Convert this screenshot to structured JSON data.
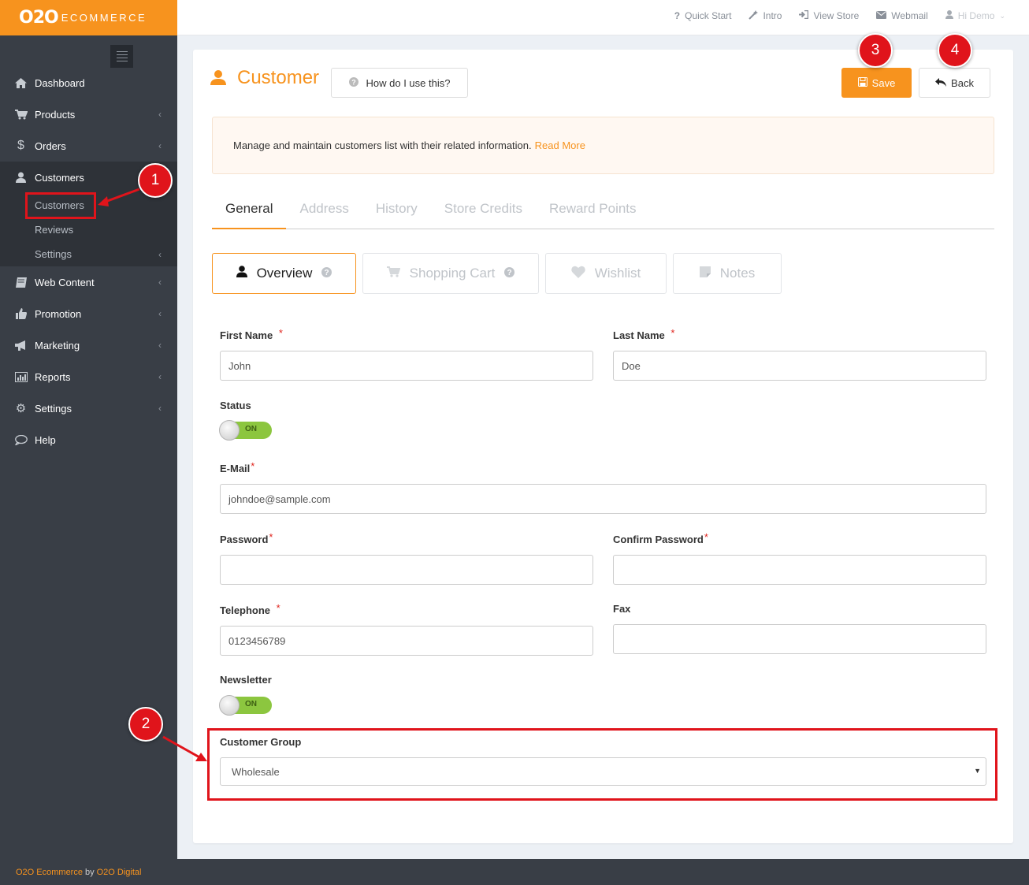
{
  "brand": {
    "logo_main": "O2O",
    "logo_sub": "ECOMMERCE"
  },
  "sidebar": {
    "items": [
      {
        "label": "Dashboard"
      },
      {
        "label": "Products"
      },
      {
        "label": "Orders"
      },
      {
        "label": "Customers",
        "children": [
          {
            "label": "Customers"
          },
          {
            "label": "Reviews"
          },
          {
            "label": "Settings"
          }
        ]
      },
      {
        "label": "Web Content"
      },
      {
        "label": "Promotion"
      },
      {
        "label": "Marketing"
      },
      {
        "label": "Reports"
      },
      {
        "label": "Settings"
      },
      {
        "label": "Help"
      }
    ]
  },
  "topbar": {
    "quick_start": "Quick Start",
    "intro": "Intro",
    "view_store": "View Store",
    "webmail": "Webmail",
    "user": "Hi Demo"
  },
  "page": {
    "title": "Customer",
    "help_label": "How do I use this?",
    "save_label": "Save",
    "back_label": "Back",
    "info_text": "Manage and maintain customers list with their related information.",
    "read_more": "Read More"
  },
  "tabs": [
    "General",
    "Address",
    "History",
    "Store Credits",
    "Reward Points"
  ],
  "subtabs": [
    "Overview",
    "Shopping Cart",
    "Wishlist",
    "Notes"
  ],
  "form": {
    "first_name_label": "First Name",
    "first_name_value": "John",
    "last_name_label": "Last Name",
    "last_name_value": "Doe",
    "status_label": "Status",
    "status_switch": "ON",
    "email_label": "E-Mail",
    "email_value": "johndoe@sample.com",
    "password_label": "Password",
    "confirm_password_label": "Confirm Password",
    "telephone_label": "Telephone",
    "telephone_value": "0123456789",
    "fax_label": "Fax",
    "newsletter_label": "Newsletter",
    "newsletter_switch": "ON",
    "customer_group_label": "Customer Group",
    "customer_group_value": "Wholesale"
  },
  "annotations": [
    "1",
    "2",
    "3",
    "4"
  ],
  "footer": {
    "product": "O2O Ecommerce",
    "by": "by",
    "company": "O2O Digital"
  },
  "colors": {
    "accent": "#f7931e",
    "sidebar": "#393e46",
    "annotation": "#e0141b",
    "switch_on": "#8cc63f"
  }
}
